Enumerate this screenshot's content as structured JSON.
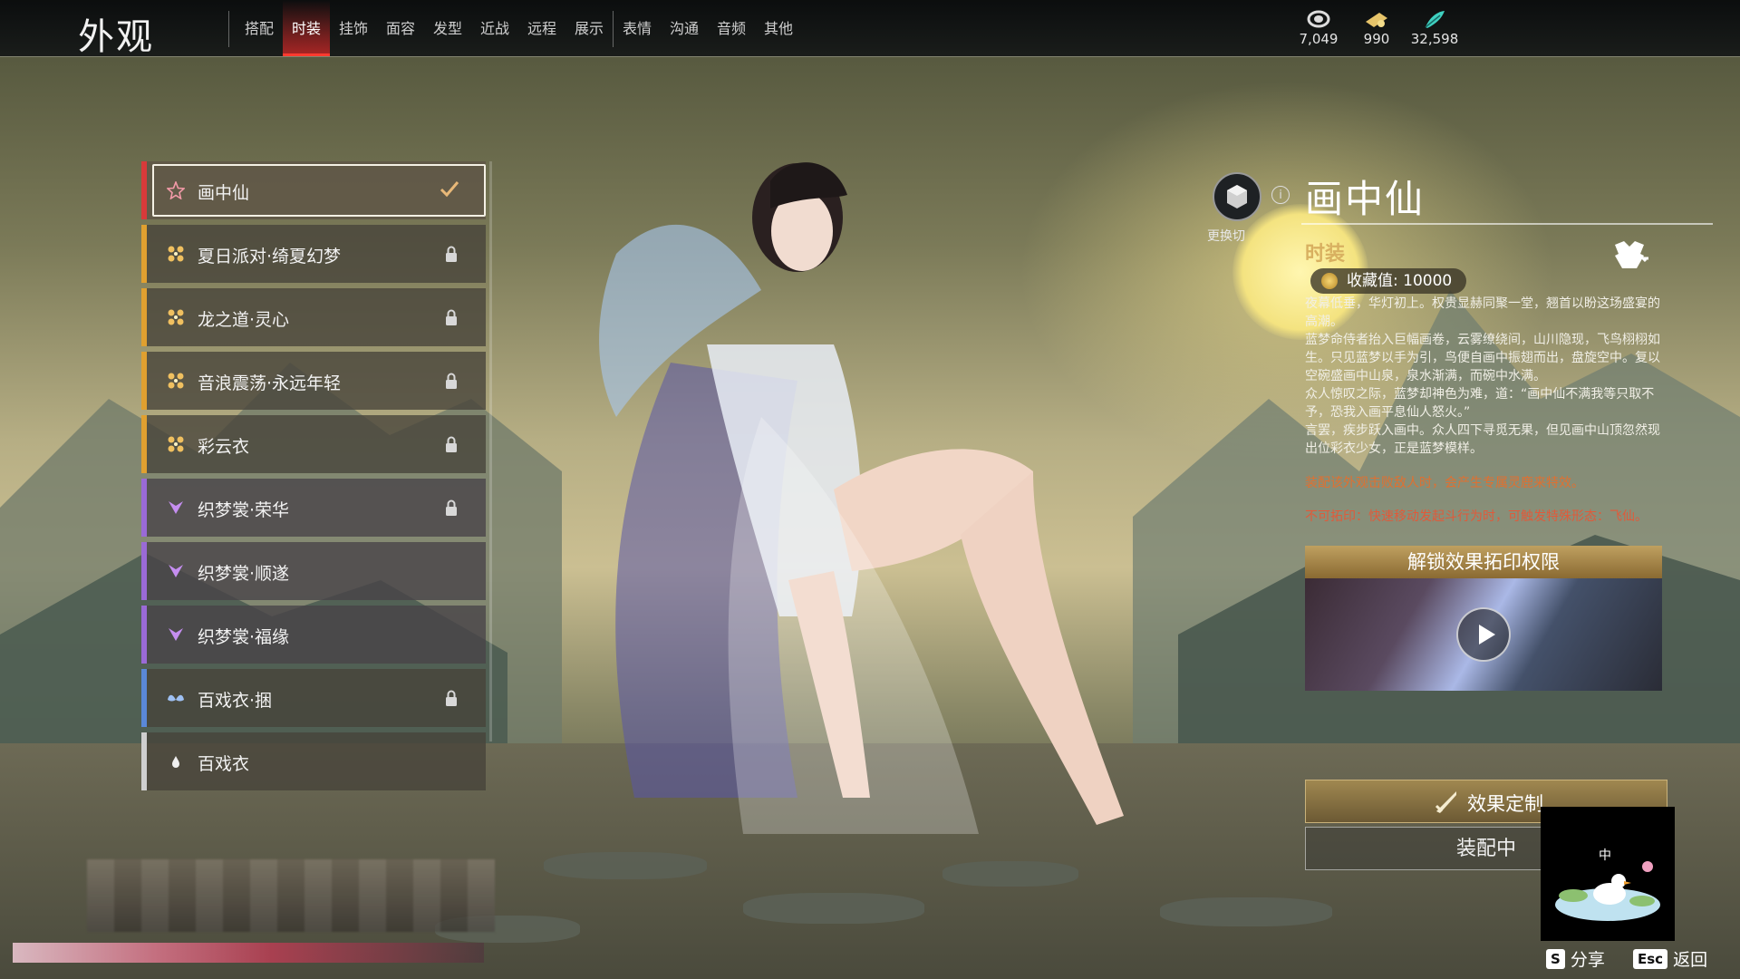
{
  "header": {
    "title": "外观",
    "tabs_group1": [
      "搭配",
      "时装",
      "挂饰",
      "面容",
      "发型",
      "近战",
      "远程",
      "展示"
    ],
    "tabs_group2": [
      "表情",
      "沟通",
      "音频",
      "其他"
    ],
    "active_tab": "时装"
  },
  "currencies": [
    {
      "icon": "coins-icon",
      "amount": "7,049"
    },
    {
      "icon": "ticket-icon",
      "amount": "990"
    },
    {
      "icon": "feather-icon",
      "amount": "32,598"
    }
  ],
  "outfits": [
    {
      "label": "画中仙",
      "rarity_color": "#d83a3a",
      "state": "equipped"
    },
    {
      "label": "夏日派对·绮夏幻梦",
      "rarity_color": "#e0a030",
      "state": "locked"
    },
    {
      "label": "龙之道·灵心",
      "rarity_color": "#e0a030",
      "state": "locked"
    },
    {
      "label": "音浪震荡·永远年轻",
      "rarity_color": "#e0a030",
      "state": "locked"
    },
    {
      "label": "彩云衣",
      "rarity_color": "#e0a030",
      "state": "locked"
    },
    {
      "label": "织梦裳·荣华",
      "rarity_color": "#9a6ad6",
      "state": "locked"
    },
    {
      "label": "织梦裳·顺遂",
      "rarity_color": "#9a6ad6",
      "state": "none"
    },
    {
      "label": "织梦裳·福缘",
      "rarity_color": "#9a6ad6",
      "state": "none"
    },
    {
      "label": "百戏衣·捆",
      "rarity_color": "#5a88d8",
      "state": "locked"
    },
    {
      "label": "百戏衣",
      "rarity_color": "#cfcfcf",
      "state": "none"
    }
  ],
  "detail": {
    "swap_label": "更换切",
    "name": "画中仙",
    "category": "时装",
    "collection": "收藏值: 10000",
    "description": [
      "夜幕低垂，华灯初上。权贵显赫同聚一堂，翘首以盼这场盛宴的高潮。",
      "蓝梦命侍者抬入巨幅画卷，云雾缭绕间，山川隐现，飞鸟栩栩如生。只见蓝梦以手为引，鸟便自画中振翅而出，盘旋空中。复以空碗盛画中山泉，泉水渐满，而碗中水满。",
      "众人惊叹之际，蓝梦却神色为难，道：“画中仙不满我等只取不予，恐我入画平息仙人怒火。”",
      "言罢，疾步跃入画中。众人四下寻觅无果，但见画中山顶忽然现出位彩衣少女，正是蓝梦模样。"
    ],
    "effect_note": "装配该外观击败敌人时，会产生专属灵鹿来特效。",
    "special_note": "不可拓印：快速移动发起斗行为时，可触发特殊形态：飞仙。",
    "unlock_title": "解锁效果拓印权限",
    "customize_label": "效果定制",
    "equip_label": "装配中"
  },
  "footer": {
    "share_key": "S",
    "share_label": "分享",
    "back_key": "Esc",
    "back_label": "返回",
    "minimap_text": "中"
  }
}
